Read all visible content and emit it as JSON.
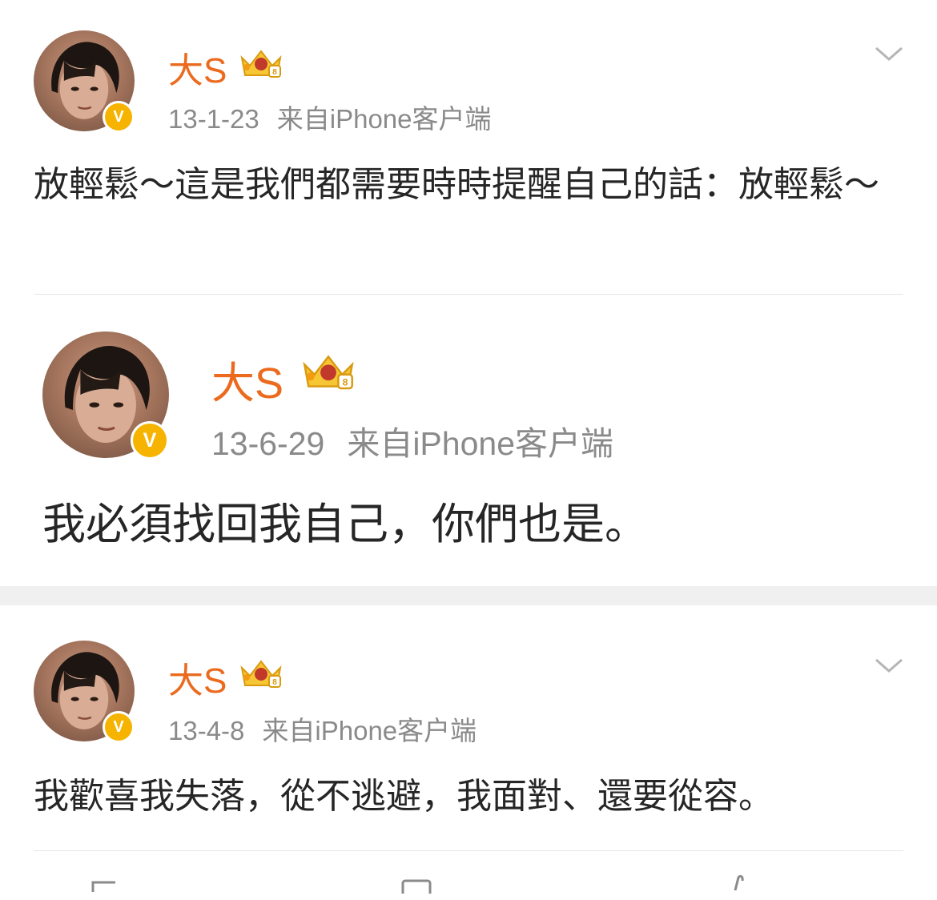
{
  "posts": [
    {
      "user_name": "大S",
      "date": "13-1-23",
      "source": "来自iPhone客户端",
      "badge": "V",
      "text": "放輕鬆～這是我們都需要時時提醒自己的話：放輕鬆～",
      "menu_icon": "chevron-down-icon"
    },
    {
      "user_name": "大S",
      "date": "13-6-29",
      "source": "来自iPhone客户端",
      "badge": "V",
      "text": "我必須找回我自己，你們也是。"
    },
    {
      "user_name": "大S",
      "date": "13-4-8",
      "source": "来自iPhone客户端",
      "badge": "V",
      "text": "我歡喜我失落，從不逃避，我面對、還要從容。",
      "menu_icon": "chevron-down-icon"
    }
  ],
  "icons": {
    "crown": "crown-badge-icon",
    "verified": "verified-v-icon",
    "menu": "chevron-down-icon"
  },
  "colors": {
    "name": "#eb6a1e",
    "meta": "#8a8a8a",
    "badge": "#f6b400",
    "text": "#262626",
    "separator_band": "#f0f0f0"
  }
}
